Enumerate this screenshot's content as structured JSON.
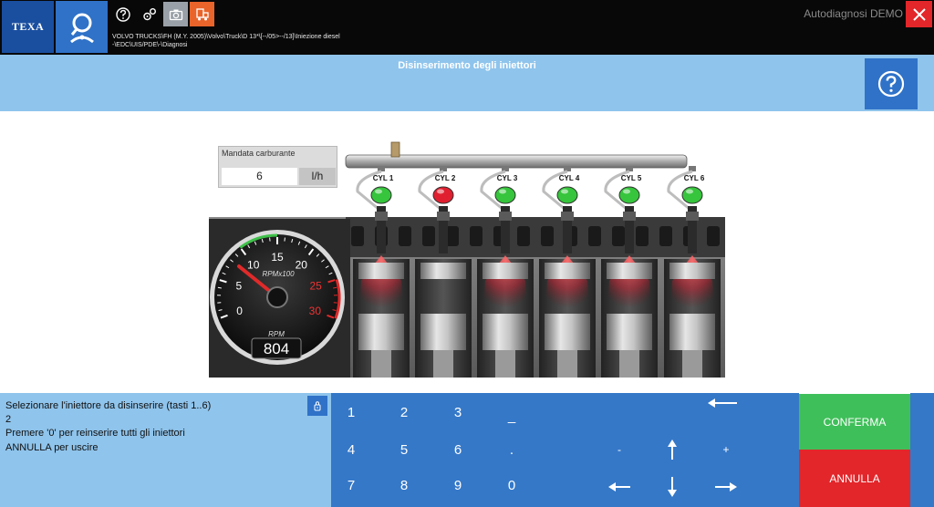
{
  "header": {
    "logo_text": "TEXA",
    "breadcrumb_line1": "VOLVO TRUCKS\\FH (M.Y. 2005)\\Volvo\\Truck\\D 13*\\[--/05>--/13]\\Iniezione diesel",
    "breadcrumb_line2": "-\\EDC\\UIS/PDE\\-\\Diagnosi",
    "app_title": "Autodiagnosi DEMO"
  },
  "page": {
    "title": "Disinserimento degli iniettori"
  },
  "fuel": {
    "label": "Mandata carburante",
    "value": "6",
    "unit": "l/h"
  },
  "cylinders": [
    {
      "label": "CYL 1",
      "status": "active"
    },
    {
      "label": "CYL 2",
      "status": "disabled"
    },
    {
      "label": "CYL 3",
      "status": "active"
    },
    {
      "label": "CYL 4",
      "status": "active"
    },
    {
      "label": "CYL 5",
      "status": "active"
    },
    {
      "label": "CYL 6",
      "status": "active"
    }
  ],
  "gauge": {
    "ticks": [
      "0",
      "5",
      "10",
      "15",
      "20",
      "25",
      "30"
    ],
    "unit_label": "RPMx100",
    "rpm_label": "RPM",
    "rpm_value": "804",
    "needle_value": 8.04,
    "max_value": 30
  },
  "instructions": {
    "line1": "Selezionare l'iniettore da disinserire (tasti 1..6)",
    "line2": "2",
    "line3": "Premere '0' per reinserire tutti gli iniettori",
    "line4": "ANNULLA per uscire"
  },
  "keypad": {
    "k1": "1",
    "k2": "2",
    "k3": "3",
    "k_underscore": "_",
    "k4": "4",
    "k5": "5",
    "k6": "6",
    "k_dot": ".",
    "k7": "7",
    "k8": "8",
    "k9": "9",
    "k0": "0",
    "minus": "-",
    "plus": "+"
  },
  "actions": {
    "confirm": "CONFERMA",
    "cancel": "ANNULLA"
  },
  "colors": {
    "topbar": "#080808",
    "accent_blue": "#2f72c8",
    "band_blue": "#8fc4ec",
    "keypad_blue": "#3578c8",
    "confirm_green": "#3fbf5a",
    "cancel_red": "#e2262a",
    "led_active": "#36c53c",
    "led_disabled": "#e02030"
  }
}
